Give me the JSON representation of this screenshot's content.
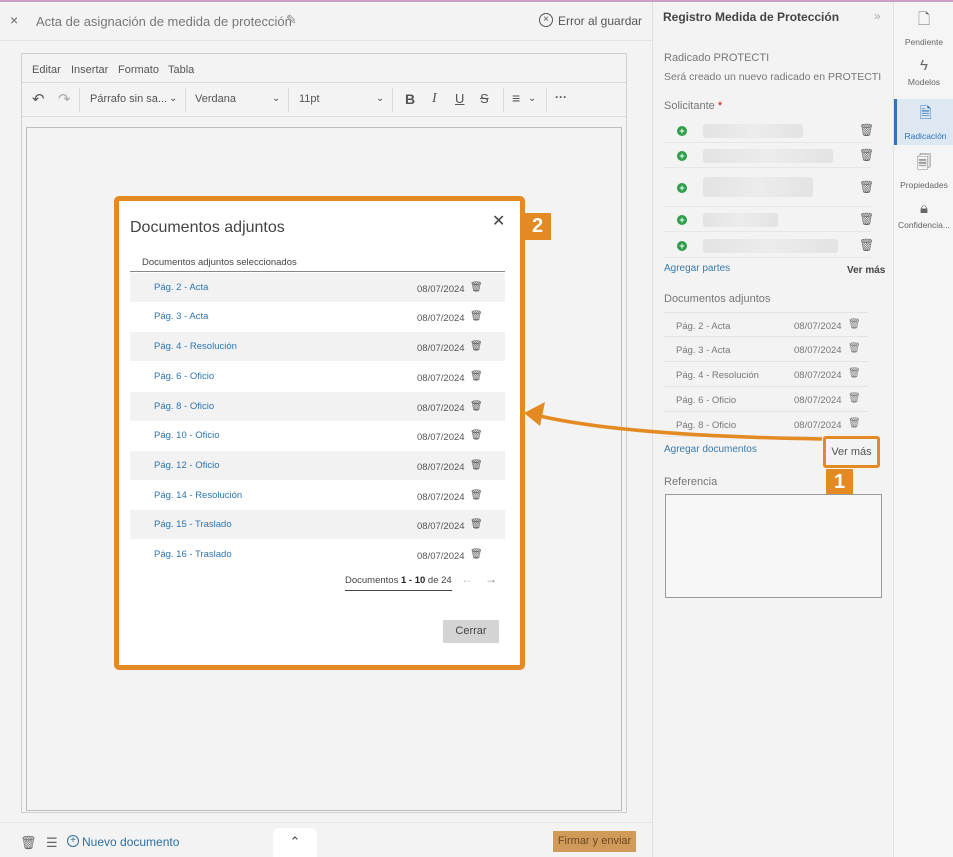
{
  "editor": {
    "close_icon": "×",
    "title": "Acta de asignación de medida de protección",
    "save_error": "Error al guardar",
    "menu": [
      "Editar",
      "Insertar",
      "Formato",
      "Tabla"
    ],
    "toolbar": {
      "paragraph": "Párrafo sin sa...",
      "font": "Verdana",
      "size": "11pt"
    },
    "bottom": {
      "new_document": "Nuevo documento",
      "sign_send": "Firmar y enviar"
    }
  },
  "panel": {
    "title": "Registro Medida de Protección",
    "radicado_label": "Radicado PROTECTI",
    "radicado_text": "Será creado un nuevo radicado en PROTECTI",
    "solicitante_label": "Solicitante",
    "required_mark": "*",
    "add_parts": "Agregar partes",
    "see_more_parts": "Ver más",
    "docs_label": "Documentos adjuntos",
    "docs": [
      {
        "name": "Pág. 2 - Acta",
        "date": "08/07/2024"
      },
      {
        "name": "Pág. 3 - Acta",
        "date": "08/07/2024"
      },
      {
        "name": "Pág. 4 - Resolución",
        "date": "08/07/2024"
      },
      {
        "name": "Pág. 6 - Oficio",
        "date": "08/07/2024"
      },
      {
        "name": "Pág. 8 - Oficio",
        "date": "08/07/2024"
      }
    ],
    "add_docs": "Agregar documentos",
    "see_more_docs": "Ver más",
    "reference_label": "Referencia"
  },
  "rail": [
    {
      "label": "Pendiente",
      "icon": "pending-icon"
    },
    {
      "label": "Modelos",
      "icon": "models-icon"
    },
    {
      "label": "Radicación",
      "icon": "filing-icon",
      "active": true
    },
    {
      "label": "Propiedades",
      "icon": "properties-icon"
    },
    {
      "label": "Confidencia...",
      "icon": "lock-icon"
    }
  ],
  "modal": {
    "title": "Documentos adjuntos",
    "subtitle": "Documentos adjuntos seleccionados",
    "rows": [
      {
        "name": "Pág. 2 - Acta",
        "date": "08/07/2024"
      },
      {
        "name": "Pág. 3 - Acta",
        "date": "08/07/2024"
      },
      {
        "name": "Pág. 4 - Resolución",
        "date": "08/07/2024"
      },
      {
        "name": "Pág. 6 - Oficio",
        "date": "08/07/2024"
      },
      {
        "name": "Pág. 8 - Oficio",
        "date": "08/07/2024"
      },
      {
        "name": "Pág. 10 - Oficio",
        "date": "08/07/2024"
      },
      {
        "name": "Pág. 12 - Oficio",
        "date": "08/07/2024"
      },
      {
        "name": "Pág. 14 - Resolución",
        "date": "08/07/2024"
      },
      {
        "name": "Pág. 15 - Traslado",
        "date": "08/07/2024"
      },
      {
        "name": "Pág. 16 - Traslado",
        "date": "08/07/2024"
      }
    ],
    "pager": {
      "prefix": "Documentos",
      "range": "1 - 10",
      "of": "de",
      "total": "24"
    },
    "close": "Cerrar"
  },
  "annotations": {
    "badge1": "1",
    "badge2": "2",
    "accent": "#e48a23"
  }
}
